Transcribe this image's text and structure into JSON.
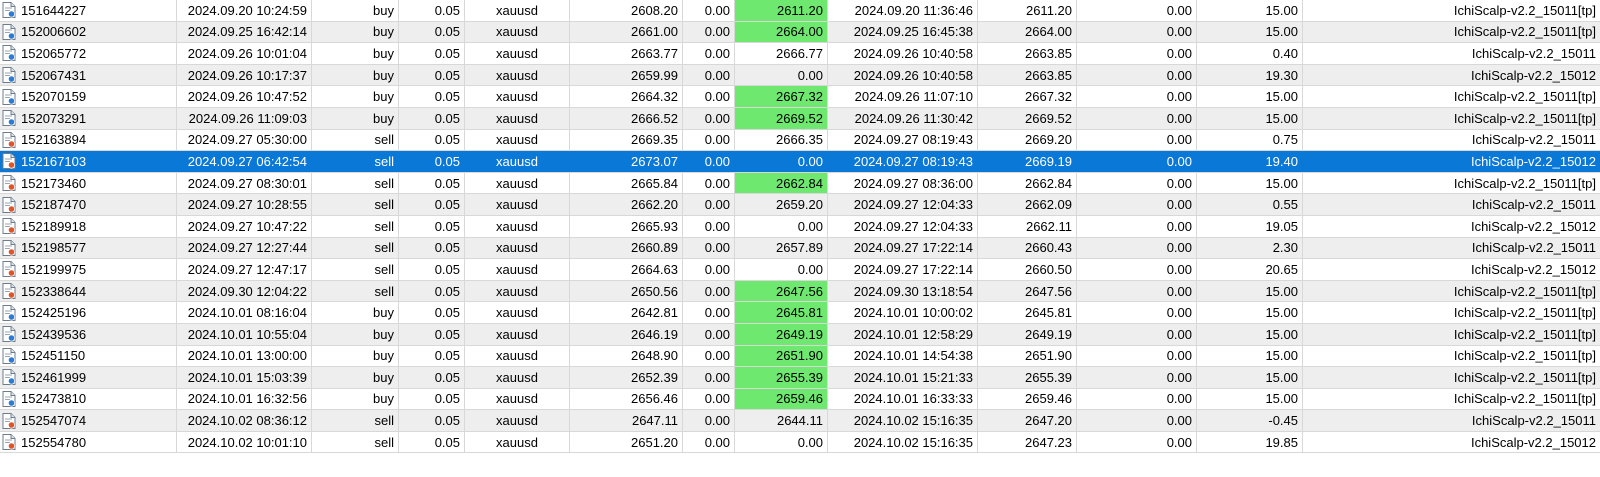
{
  "colors": {
    "selected_row": "#0a78d7",
    "tp_hit": "#6ee86e",
    "buy_badge": "#2b7bd6",
    "sell_badge": "#e0542a",
    "alt_row": "#eeeeee"
  },
  "rows": [
    {
      "ticket": "151644227",
      "open_time": "2024.09.20 10:24:59",
      "type": "buy",
      "volume": "0.05",
      "symbol": "xauusd",
      "open_price": "2608.20",
      "sl": "0.00",
      "tp": "2611.20",
      "close_time": "2024.09.20 11:36:46",
      "close_price": "2611.20",
      "swap": "0.00",
      "profit": "15.00",
      "comment": "IchiScalp-v2.2_15011[tp]",
      "tp_hit": true,
      "icon": "buy-order-icon"
    },
    {
      "ticket": "152006602",
      "open_time": "2024.09.25 16:42:14",
      "type": "buy",
      "volume": "0.05",
      "symbol": "xauusd",
      "open_price": "2661.00",
      "sl": "0.00",
      "tp": "2664.00",
      "close_time": "2024.09.25 16:45:38",
      "close_price": "2664.00",
      "swap": "0.00",
      "profit": "15.00",
      "comment": "IchiScalp-v2.2_15011[tp]",
      "tp_hit": true,
      "icon": "buy-order-icon"
    },
    {
      "ticket": "152065772",
      "open_time": "2024.09.26 10:01:04",
      "type": "buy",
      "volume": "0.05",
      "symbol": "xauusd",
      "open_price": "2663.77",
      "sl": "0.00",
      "tp": "2666.77",
      "close_time": "2024.09.26 10:40:58",
      "close_price": "2663.85",
      "swap": "0.00",
      "profit": "0.40",
      "comment": "IchiScalp-v2.2_15011",
      "tp_hit": false,
      "icon": "buy-order-icon"
    },
    {
      "ticket": "152067431",
      "open_time": "2024.09.26 10:17:37",
      "type": "buy",
      "volume": "0.05",
      "symbol": "xauusd",
      "open_price": "2659.99",
      "sl": "0.00",
      "tp": "0.00",
      "close_time": "2024.09.26 10:40:58",
      "close_price": "2663.85",
      "swap": "0.00",
      "profit": "19.30",
      "comment": "IchiScalp-v2.2_15012",
      "tp_hit": false,
      "icon": "buy-order-icon"
    },
    {
      "ticket": "152070159",
      "open_time": "2024.09.26 10:47:52",
      "type": "buy",
      "volume": "0.05",
      "symbol": "xauusd",
      "open_price": "2664.32",
      "sl": "0.00",
      "tp": "2667.32",
      "close_time": "2024.09.26 11:07:10",
      "close_price": "2667.32",
      "swap": "0.00",
      "profit": "15.00",
      "comment": "IchiScalp-v2.2_15011[tp]",
      "tp_hit": true,
      "icon": "buy-order-icon"
    },
    {
      "ticket": "152073291",
      "open_time": "2024.09.26 11:09:03",
      "type": "buy",
      "volume": "0.05",
      "symbol": "xauusd",
      "open_price": "2666.52",
      "sl": "0.00",
      "tp": "2669.52",
      "close_time": "2024.09.26 11:30:42",
      "close_price": "2669.52",
      "swap": "0.00",
      "profit": "15.00",
      "comment": "IchiScalp-v2.2_15011[tp]",
      "tp_hit": true,
      "icon": "buy-order-icon"
    },
    {
      "ticket": "152163894",
      "open_time": "2024.09.27 05:30:00",
      "type": "sell",
      "volume": "0.05",
      "symbol": "xauusd",
      "open_price": "2669.35",
      "sl": "0.00",
      "tp": "2666.35",
      "close_time": "2024.09.27 08:19:43",
      "close_price": "2669.20",
      "swap": "0.00",
      "profit": "0.75",
      "comment": "IchiScalp-v2.2_15011",
      "tp_hit": false,
      "icon": "sell-order-icon"
    },
    {
      "ticket": "152167103",
      "open_time": "2024.09.27 06:42:54",
      "type": "sell",
      "volume": "0.05",
      "symbol": "xauusd",
      "open_price": "2673.07",
      "sl": "0.00",
      "tp": "0.00",
      "close_time": "2024.09.27 08:19:43",
      "close_price": "2669.19",
      "swap": "0.00",
      "profit": "19.40",
      "comment": "IchiScalp-v2.2_15012",
      "tp_hit": false,
      "selected": true,
      "icon": "sell-order-icon"
    },
    {
      "ticket": "152173460",
      "open_time": "2024.09.27 08:30:01",
      "type": "sell",
      "volume": "0.05",
      "symbol": "xauusd",
      "open_price": "2665.84",
      "sl": "0.00",
      "tp": "2662.84",
      "close_time": "2024.09.27 08:36:00",
      "close_price": "2662.84",
      "swap": "0.00",
      "profit": "15.00",
      "comment": "IchiScalp-v2.2_15011[tp]",
      "tp_hit": true,
      "icon": "sell-order-icon"
    },
    {
      "ticket": "152187470",
      "open_time": "2024.09.27 10:28:55",
      "type": "sell",
      "volume": "0.05",
      "symbol": "xauusd",
      "open_price": "2662.20",
      "sl": "0.00",
      "tp": "2659.20",
      "close_time": "2024.09.27 12:04:33",
      "close_price": "2662.09",
      "swap": "0.00",
      "profit": "0.55",
      "comment": "IchiScalp-v2.2_15011",
      "tp_hit": false,
      "icon": "sell-order-icon"
    },
    {
      "ticket": "152189918",
      "open_time": "2024.09.27 10:47:22",
      "type": "sell",
      "volume": "0.05",
      "symbol": "xauusd",
      "open_price": "2665.93",
      "sl": "0.00",
      "tp": "0.00",
      "close_time": "2024.09.27 12:04:33",
      "close_price": "2662.11",
      "swap": "0.00",
      "profit": "19.05",
      "comment": "IchiScalp-v2.2_15012",
      "tp_hit": false,
      "icon": "sell-order-icon"
    },
    {
      "ticket": "152198577",
      "open_time": "2024.09.27 12:27:44",
      "type": "sell",
      "volume": "0.05",
      "symbol": "xauusd",
      "open_price": "2660.89",
      "sl": "0.00",
      "tp": "2657.89",
      "close_time": "2024.09.27 17:22:14",
      "close_price": "2660.43",
      "swap": "0.00",
      "profit": "2.30",
      "comment": "IchiScalp-v2.2_15011",
      "tp_hit": false,
      "icon": "sell-order-icon"
    },
    {
      "ticket": "152199975",
      "open_time": "2024.09.27 12:47:17",
      "type": "sell",
      "volume": "0.05",
      "symbol": "xauusd",
      "open_price": "2664.63",
      "sl": "0.00",
      "tp": "0.00",
      "close_time": "2024.09.27 17:22:14",
      "close_price": "2660.50",
      "swap": "0.00",
      "profit": "20.65",
      "comment": "IchiScalp-v2.2_15012",
      "tp_hit": false,
      "icon": "sell-order-icon"
    },
    {
      "ticket": "152338644",
      "open_time": "2024.09.30 12:04:22",
      "type": "sell",
      "volume": "0.05",
      "symbol": "xauusd",
      "open_price": "2650.56",
      "sl": "0.00",
      "tp": "2647.56",
      "close_time": "2024.09.30 13:18:54",
      "close_price": "2647.56",
      "swap": "0.00",
      "profit": "15.00",
      "comment": "IchiScalp-v2.2_15011[tp]",
      "tp_hit": true,
      "icon": "sell-order-icon"
    },
    {
      "ticket": "152425196",
      "open_time": "2024.10.01 08:16:04",
      "type": "buy",
      "volume": "0.05",
      "symbol": "xauusd",
      "open_price": "2642.81",
      "sl": "0.00",
      "tp": "2645.81",
      "close_time": "2024.10.01 10:00:02",
      "close_price": "2645.81",
      "swap": "0.00",
      "profit": "15.00",
      "comment": "IchiScalp-v2.2_15011[tp]",
      "tp_hit": true,
      "icon": "buy-order-icon"
    },
    {
      "ticket": "152439536",
      "open_time": "2024.10.01 10:55:04",
      "type": "buy",
      "volume": "0.05",
      "symbol": "xauusd",
      "open_price": "2646.19",
      "sl": "0.00",
      "tp": "2649.19",
      "close_time": "2024.10.01 12:58:29",
      "close_price": "2649.19",
      "swap": "0.00",
      "profit": "15.00",
      "comment": "IchiScalp-v2.2_15011[tp]",
      "tp_hit": true,
      "icon": "buy-order-icon"
    },
    {
      "ticket": "152451150",
      "open_time": "2024.10.01 13:00:00",
      "type": "buy",
      "volume": "0.05",
      "symbol": "xauusd",
      "open_price": "2648.90",
      "sl": "0.00",
      "tp": "2651.90",
      "close_time": "2024.10.01 14:54:38",
      "close_price": "2651.90",
      "swap": "0.00",
      "profit": "15.00",
      "comment": "IchiScalp-v2.2_15011[tp]",
      "tp_hit": true,
      "icon": "buy-order-icon"
    },
    {
      "ticket": "152461999",
      "open_time": "2024.10.01 15:03:39",
      "type": "buy",
      "volume": "0.05",
      "symbol": "xauusd",
      "open_price": "2652.39",
      "sl": "0.00",
      "tp": "2655.39",
      "close_time": "2024.10.01 15:21:33",
      "close_price": "2655.39",
      "swap": "0.00",
      "profit": "15.00",
      "comment": "IchiScalp-v2.2_15011[tp]",
      "tp_hit": true,
      "icon": "buy-order-icon"
    },
    {
      "ticket": "152473810",
      "open_time": "2024.10.01 16:32:56",
      "type": "buy",
      "volume": "0.05",
      "symbol": "xauusd",
      "open_price": "2656.46",
      "sl": "0.00",
      "tp": "2659.46",
      "close_time": "2024.10.01 16:33:33",
      "close_price": "2659.46",
      "swap": "0.00",
      "profit": "15.00",
      "comment": "IchiScalp-v2.2_15011[tp]",
      "tp_hit": true,
      "icon": "buy-order-icon"
    },
    {
      "ticket": "152547074",
      "open_time": "2024.10.02 08:36:12",
      "type": "sell",
      "volume": "0.05",
      "symbol": "xauusd",
      "open_price": "2647.11",
      "sl": "0.00",
      "tp": "2644.11",
      "close_time": "2024.10.02 15:16:35",
      "close_price": "2647.20",
      "swap": "0.00",
      "profit": "-0.45",
      "comment": "IchiScalp-v2.2_15011",
      "tp_hit": false,
      "icon": "sell-order-icon"
    },
    {
      "ticket": "152554780",
      "open_time": "2024.10.02 10:01:10",
      "type": "sell",
      "volume": "0.05",
      "symbol": "xauusd",
      "open_price": "2651.20",
      "sl": "0.00",
      "tp": "0.00",
      "close_time": "2024.10.02 15:16:35",
      "close_price": "2647.23",
      "swap": "0.00",
      "profit": "19.85",
      "comment": "IchiScalp-v2.2_15012",
      "tp_hit": false,
      "icon": "sell-order-icon"
    }
  ]
}
